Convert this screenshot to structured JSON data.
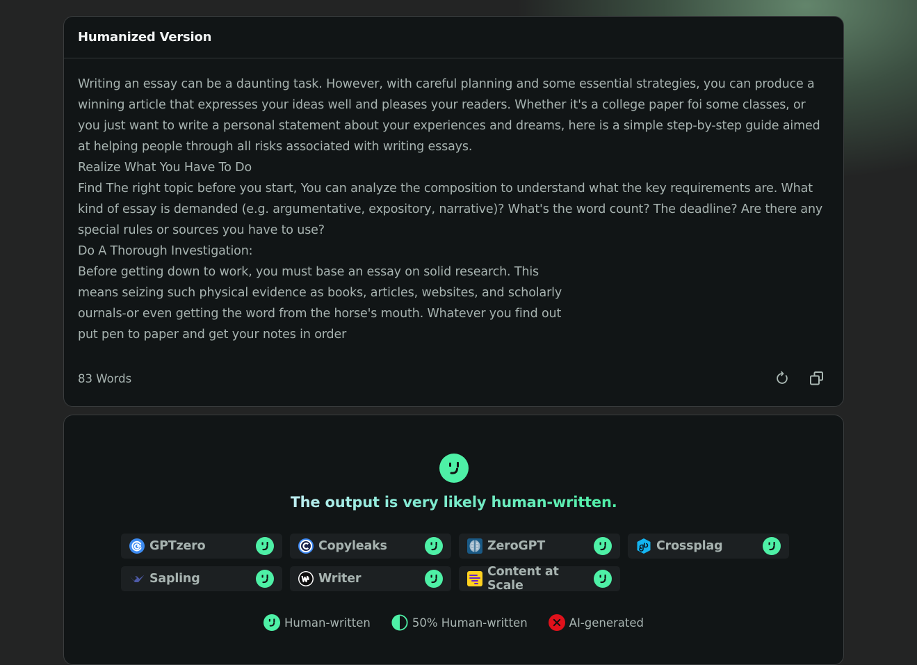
{
  "humanized": {
    "title": "Humanized Version",
    "paragraphs": [
      "Writing an essay can be a daunting task. However, with careful planning and some essential strategies, you can produce a winning article that expresses your ideas well and pleases your readers. Whether it's a college paper foi some classes, or you just want to write a personal statement about your experiences and dreams, here is a simple step-by-step guide aimed at helping people through all risks associated with writing essays.",
      "Realize What You Have To Do",
      "Find The right topic before you start, You can analyze the composition to understand what the key requirements are. What kind of essay is demanded (e.g. argumentative, expository, narrative)? What's the word count? The deadline? Are there any special rules or sources you have to use?",
      "Do A Thorough Investigation:",
      "Before getting down to work, you must base an essay on solid research. This\nmeans seizing such physical evidence as books, articles, websites, and scholarly\nournals-or even getting the word from the horse's mouth. Whatever you find out\nput pen to paper and get your notes in order"
    ],
    "word_count": "83 Words",
    "actions": {
      "regenerate_icon": "refresh-icon",
      "copy_icon": "copy-icon"
    }
  },
  "detection": {
    "verdict_icon": "smiley-face-icon",
    "verdict_text": "The output is very likely human-written.",
    "detectors": [
      {
        "name": "GPTzero",
        "logo": "gptzero-logo",
        "result": "human-written"
      },
      {
        "name": "Copyleaks",
        "logo": "copyleaks-logo",
        "result": "human-written"
      },
      {
        "name": "ZeroGPT",
        "logo": "zerogpt-logo",
        "result": "human-written"
      },
      {
        "name": "Crossplag",
        "logo": "crossplag-logo",
        "result": "human-written"
      },
      {
        "name": "Sapling",
        "logo": "sapling-logo",
        "result": "human-written"
      },
      {
        "name": "Writer",
        "logo": "writer-logo",
        "result": "human-written"
      },
      {
        "name": "Content at Scale",
        "logo": "content-at-scale-logo",
        "result": "human-written"
      }
    ],
    "legend": [
      {
        "label": "Human-written",
        "icon": "smiley-face-icon"
      },
      {
        "label": "50% Human-written",
        "icon": "half-circle-icon"
      },
      {
        "label": "AI-generated",
        "icon": "x-circle-icon"
      }
    ]
  },
  "colors": {
    "human": "#4ef0a6",
    "ai": "#e0111b",
    "card_bg": "#111516",
    "page_bg": "#232424",
    "text": "#a7b3b0"
  }
}
